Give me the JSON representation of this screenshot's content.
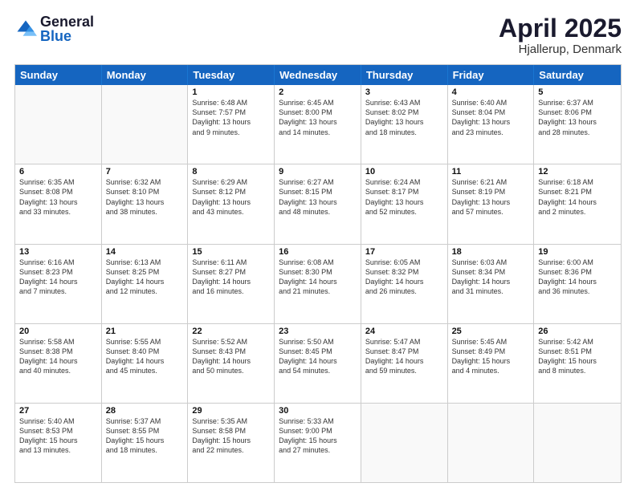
{
  "logo": {
    "general": "General",
    "blue": "Blue"
  },
  "title": "April 2025",
  "location": "Hjallerup, Denmark",
  "days": [
    "Sunday",
    "Monday",
    "Tuesday",
    "Wednesday",
    "Thursday",
    "Friday",
    "Saturday"
  ],
  "weeks": [
    [
      {
        "day": "",
        "info": ""
      },
      {
        "day": "",
        "info": ""
      },
      {
        "day": "1",
        "info": "Sunrise: 6:48 AM\nSunset: 7:57 PM\nDaylight: 13 hours\nand 9 minutes."
      },
      {
        "day": "2",
        "info": "Sunrise: 6:45 AM\nSunset: 8:00 PM\nDaylight: 13 hours\nand 14 minutes."
      },
      {
        "day": "3",
        "info": "Sunrise: 6:43 AM\nSunset: 8:02 PM\nDaylight: 13 hours\nand 18 minutes."
      },
      {
        "day": "4",
        "info": "Sunrise: 6:40 AM\nSunset: 8:04 PM\nDaylight: 13 hours\nand 23 minutes."
      },
      {
        "day": "5",
        "info": "Sunrise: 6:37 AM\nSunset: 8:06 PM\nDaylight: 13 hours\nand 28 minutes."
      }
    ],
    [
      {
        "day": "6",
        "info": "Sunrise: 6:35 AM\nSunset: 8:08 PM\nDaylight: 13 hours\nand 33 minutes."
      },
      {
        "day": "7",
        "info": "Sunrise: 6:32 AM\nSunset: 8:10 PM\nDaylight: 13 hours\nand 38 minutes."
      },
      {
        "day": "8",
        "info": "Sunrise: 6:29 AM\nSunset: 8:12 PM\nDaylight: 13 hours\nand 43 minutes."
      },
      {
        "day": "9",
        "info": "Sunrise: 6:27 AM\nSunset: 8:15 PM\nDaylight: 13 hours\nand 48 minutes."
      },
      {
        "day": "10",
        "info": "Sunrise: 6:24 AM\nSunset: 8:17 PM\nDaylight: 13 hours\nand 52 minutes."
      },
      {
        "day": "11",
        "info": "Sunrise: 6:21 AM\nSunset: 8:19 PM\nDaylight: 13 hours\nand 57 minutes."
      },
      {
        "day": "12",
        "info": "Sunrise: 6:18 AM\nSunset: 8:21 PM\nDaylight: 14 hours\nand 2 minutes."
      }
    ],
    [
      {
        "day": "13",
        "info": "Sunrise: 6:16 AM\nSunset: 8:23 PM\nDaylight: 14 hours\nand 7 minutes."
      },
      {
        "day": "14",
        "info": "Sunrise: 6:13 AM\nSunset: 8:25 PM\nDaylight: 14 hours\nand 12 minutes."
      },
      {
        "day": "15",
        "info": "Sunrise: 6:11 AM\nSunset: 8:27 PM\nDaylight: 14 hours\nand 16 minutes."
      },
      {
        "day": "16",
        "info": "Sunrise: 6:08 AM\nSunset: 8:30 PM\nDaylight: 14 hours\nand 21 minutes."
      },
      {
        "day": "17",
        "info": "Sunrise: 6:05 AM\nSunset: 8:32 PM\nDaylight: 14 hours\nand 26 minutes."
      },
      {
        "day": "18",
        "info": "Sunrise: 6:03 AM\nSunset: 8:34 PM\nDaylight: 14 hours\nand 31 minutes."
      },
      {
        "day": "19",
        "info": "Sunrise: 6:00 AM\nSunset: 8:36 PM\nDaylight: 14 hours\nand 36 minutes."
      }
    ],
    [
      {
        "day": "20",
        "info": "Sunrise: 5:58 AM\nSunset: 8:38 PM\nDaylight: 14 hours\nand 40 minutes."
      },
      {
        "day": "21",
        "info": "Sunrise: 5:55 AM\nSunset: 8:40 PM\nDaylight: 14 hours\nand 45 minutes."
      },
      {
        "day": "22",
        "info": "Sunrise: 5:52 AM\nSunset: 8:43 PM\nDaylight: 14 hours\nand 50 minutes."
      },
      {
        "day": "23",
        "info": "Sunrise: 5:50 AM\nSunset: 8:45 PM\nDaylight: 14 hours\nand 54 minutes."
      },
      {
        "day": "24",
        "info": "Sunrise: 5:47 AM\nSunset: 8:47 PM\nDaylight: 14 hours\nand 59 minutes."
      },
      {
        "day": "25",
        "info": "Sunrise: 5:45 AM\nSunset: 8:49 PM\nDaylight: 15 hours\nand 4 minutes."
      },
      {
        "day": "26",
        "info": "Sunrise: 5:42 AM\nSunset: 8:51 PM\nDaylight: 15 hours\nand 8 minutes."
      }
    ],
    [
      {
        "day": "27",
        "info": "Sunrise: 5:40 AM\nSunset: 8:53 PM\nDaylight: 15 hours\nand 13 minutes."
      },
      {
        "day": "28",
        "info": "Sunrise: 5:37 AM\nSunset: 8:55 PM\nDaylight: 15 hours\nand 18 minutes."
      },
      {
        "day": "29",
        "info": "Sunrise: 5:35 AM\nSunset: 8:58 PM\nDaylight: 15 hours\nand 22 minutes."
      },
      {
        "day": "30",
        "info": "Sunrise: 5:33 AM\nSunset: 9:00 PM\nDaylight: 15 hours\nand 27 minutes."
      },
      {
        "day": "",
        "info": ""
      },
      {
        "day": "",
        "info": ""
      },
      {
        "day": "",
        "info": ""
      }
    ]
  ]
}
